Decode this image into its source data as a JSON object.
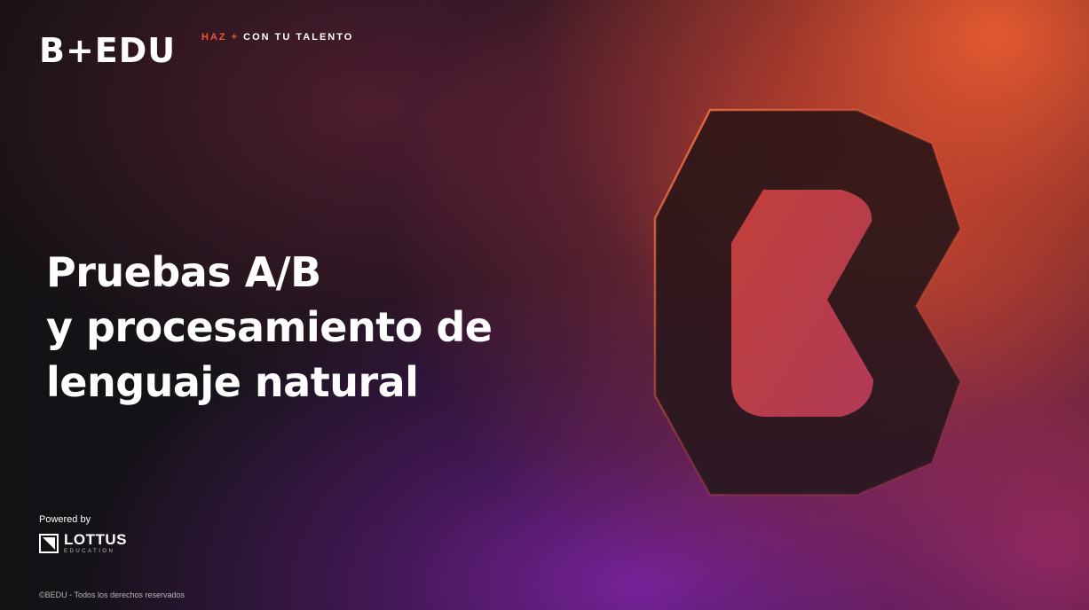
{
  "brand": {
    "logo_text": "B+EDU"
  },
  "tagline": {
    "accent": "HAZ +",
    "rest": "CON TU TALENTO"
  },
  "headline": {
    "lines": [
      "Pruebas A/B",
      "y procesamiento de",
      "lenguaje natural"
    ]
  },
  "footer": {
    "powered_by": "Powered by",
    "partner_name": "LOTTUS",
    "partner_sub": "EDUCATION",
    "copyright": "©BEDU - Todos los derechos reservados"
  },
  "colors": {
    "accent": "#f0562e",
    "text": "#ffffff",
    "background_dark": "#141216",
    "glow_orange": "#ea5c30",
    "glow_purple": "#7c22a0"
  },
  "icons": {
    "hero": "b-monogram-icon",
    "partner": "lottus-logo-icon"
  }
}
